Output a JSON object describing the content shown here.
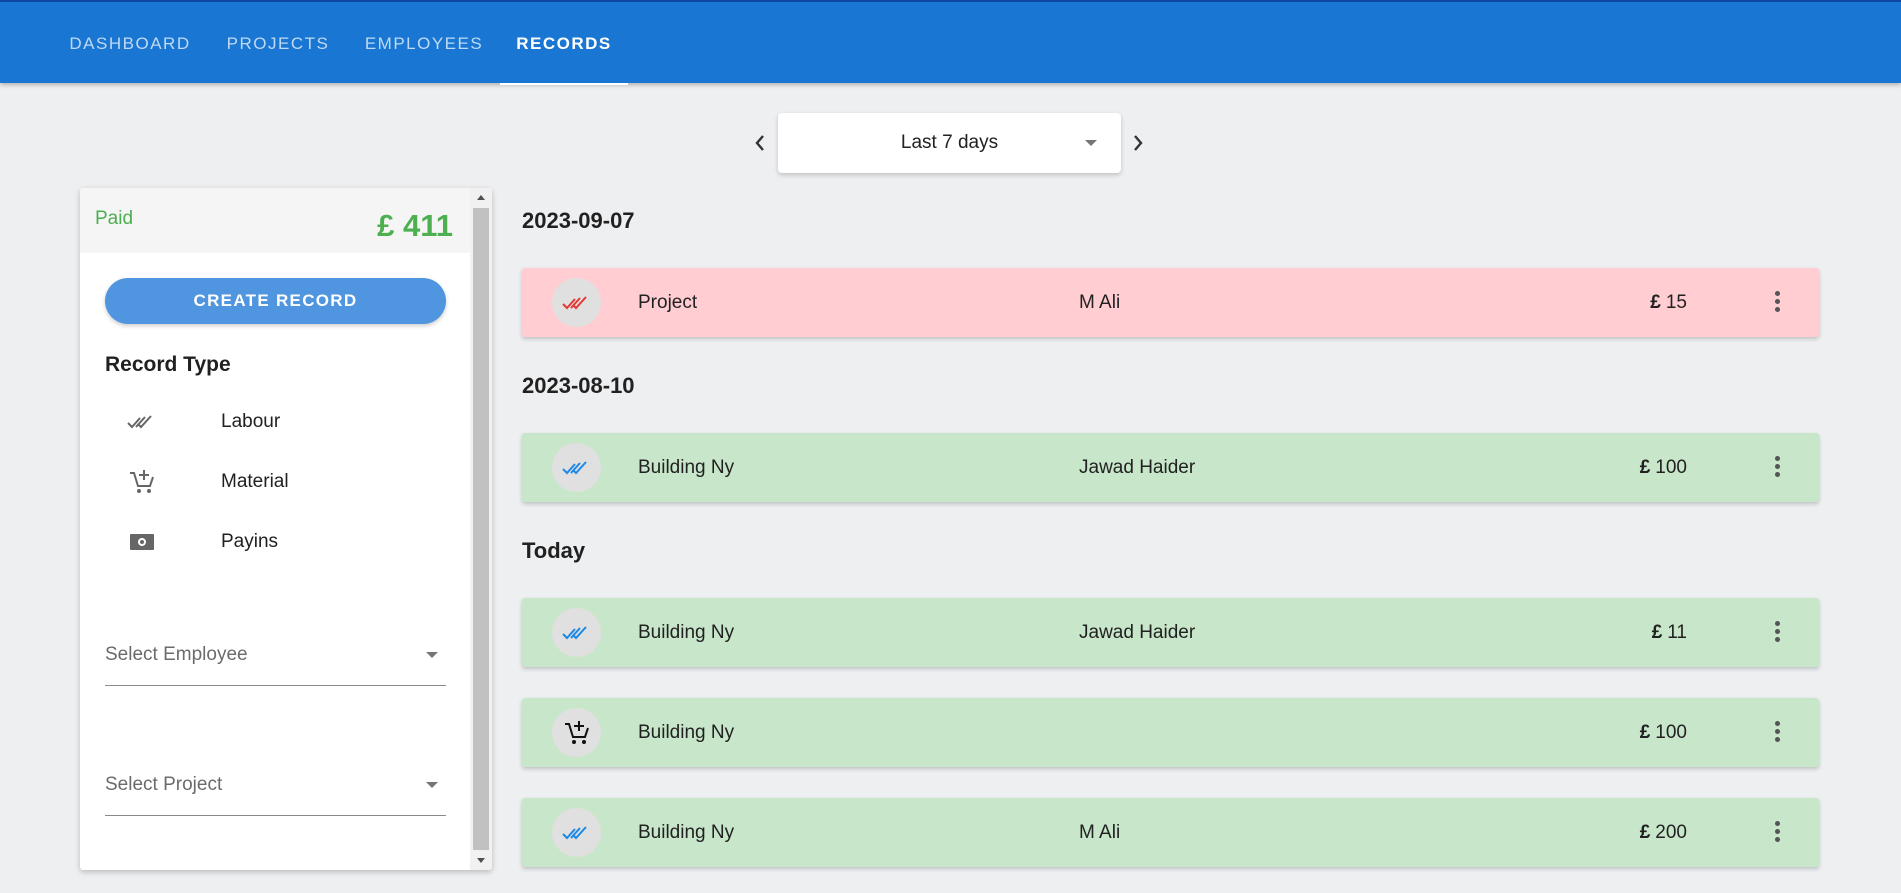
{
  "tabs": [
    {
      "label": "DASHBOARD"
    },
    {
      "label": "PROJECTS"
    },
    {
      "label": "EMPLOYEES"
    },
    {
      "label": "RECORDS",
      "active": true
    }
  ],
  "period": {
    "value": "Last 7 days",
    "prev_icon": "chevron-left-icon",
    "next_icon": "chevron-right-icon"
  },
  "summary": {
    "label": "Paid",
    "currency": "£",
    "amount": "411"
  },
  "sidebar": {
    "create_label": "CREATE RECORD",
    "record_type_title": "Record Type",
    "record_types": [
      {
        "label": "Labour",
        "icon": "double-check-icon"
      },
      {
        "label": "Material",
        "icon": "add-cart-icon"
      },
      {
        "label": "Payins",
        "icon": "cash-icon"
      }
    ],
    "employee_placeholder": "Select Employee",
    "project_placeholder": "Select Project"
  },
  "groups": [
    {
      "date": "2023-09-07",
      "records": [
        {
          "project": "Project",
          "employee": "M Ali",
          "currency": "£",
          "amount": "15",
          "icon": "double-check-icon",
          "status": "unpaid"
        }
      ]
    },
    {
      "date": "2023-08-10",
      "records": [
        {
          "project": "Building Ny",
          "employee": "Jawad Haider",
          "currency": "£",
          "amount": "100",
          "icon": "double-check-icon",
          "status": "paid"
        }
      ]
    },
    {
      "date": "Today",
      "records": [
        {
          "project": "Building Ny",
          "employee": "Jawad Haider",
          "currency": "£",
          "amount": "11",
          "icon": "double-check-icon",
          "status": "paid"
        },
        {
          "project": "Building Ny",
          "employee": "",
          "currency": "£",
          "amount": "100",
          "icon": "add-cart-icon",
          "status": "paid"
        },
        {
          "project": "Building Ny",
          "employee": "M Ali",
          "currency": "£",
          "amount": "200",
          "icon": "double-check-icon",
          "status": "paid"
        }
      ]
    }
  ],
  "colors": {
    "appbar": "#1976d2",
    "paid_row": "#c8e6c9",
    "unpaid_row": "#ffcdd2",
    "paid_text": "#4caf50",
    "check_paid": "#1e88e5",
    "check_unpaid": "#e53935"
  }
}
